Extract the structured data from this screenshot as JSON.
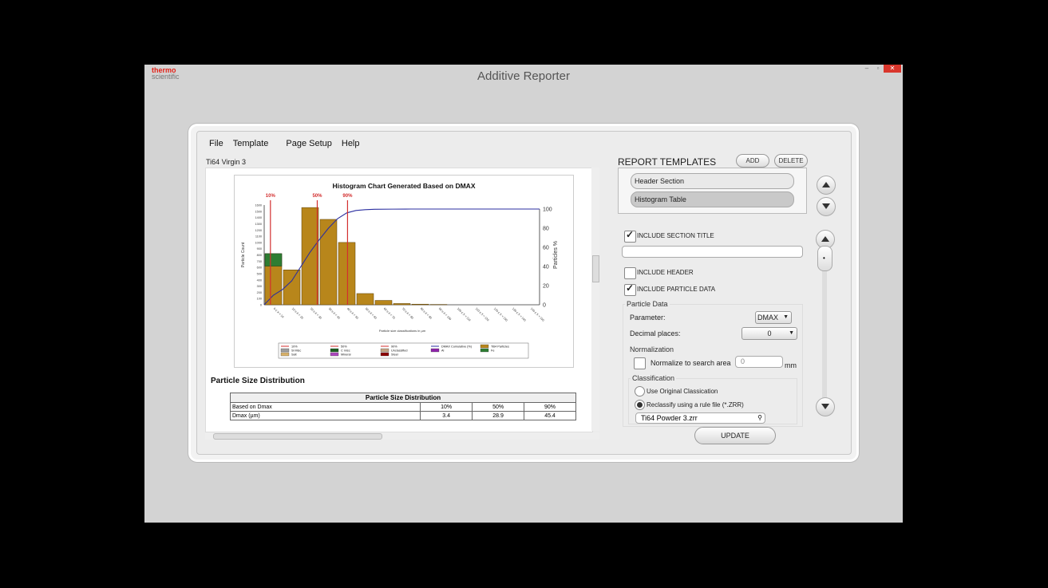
{
  "window": {
    "logo_line1": "thermo",
    "logo_line2": "scientific",
    "title": "Additive Reporter"
  },
  "menu": {
    "file": "File",
    "template": "Template",
    "page_setup": "Page Setup",
    "help": "Help"
  },
  "document": {
    "tab_label": "Ti64 Virgin 3",
    "section_title": "Particle Size Distribution"
  },
  "table": {
    "caption": "Particle Size Distribution",
    "rows": [
      {
        "label": "Based on Dmax",
        "v10": "10%",
        "v50": "50%",
        "v90": "90%"
      },
      {
        "label": "Dmax (µm)",
        "v10": "3.4",
        "v50": "28.9",
        "v90": "45.4"
      }
    ]
  },
  "chart_data": {
    "type": "bar",
    "title": "Histogram Chart Generated Based on DMAX",
    "xlabel": "Particle size classifications in µm",
    "ylabel": "Particle Count",
    "ylabel_right": "Particles %",
    "categories": [
      "0 ≤ X < 10",
      "10 ≤ X < 20",
      "20 ≤ X < 30",
      "30 ≤ X < 40",
      "40 ≤ X < 50",
      "50 ≤ X < 60",
      "60 ≤ X < 70",
      "70 ≤ X < 80",
      "80 ≤ X < 90",
      "90 ≤ X < 100",
      "100 ≤ X < 110",
      "110 ≤ X < 120",
      "120 ≤ X < 130",
      "130 ≤ X < 140",
      "140 ≤ X < 150"
    ],
    "left_ticks": [
      0,
      100,
      200,
      300,
      400,
      500,
      600,
      700,
      800,
      900,
      1000,
      1100,
      1200,
      1300,
      1400,
      1500,
      1600
    ],
    "ylim": [
      0,
      1600
    ],
    "right_ticks": [
      0,
      20,
      40,
      60,
      80,
      100
    ],
    "series": [
      {
        "name": "Ti64 Particles",
        "color": "#b8861b",
        "values": [
          820,
          560,
          1560,
          1370,
          1000,
          180,
          70,
          20,
          10,
          5,
          0,
          0,
          0,
          0,
          0
        ]
      },
      {
        "name": "Fe",
        "color": "#2e7d32",
        "values": [
          200,
          0,
          0,
          0,
          0,
          0,
          0,
          0,
          0,
          0,
          0,
          0,
          0,
          0,
          0
        ]
      },
      {
        "name": "DMAX Cumulative (%)",
        "color": "#2b2fa0",
        "type": "line",
        "x": [
          0,
          5,
          10,
          15,
          20,
          25,
          30,
          35,
          40,
          45,
          50,
          55,
          60,
          70,
          80,
          100,
          150
        ],
        "values": [
          0,
          10,
          16,
          25,
          40,
          55,
          68,
          80,
          90,
          96,
          98.5,
          99.3,
          99.7,
          99.9,
          100,
          100,
          100
        ]
      }
    ],
    "percentile_lines": [
      {
        "label": "10%",
        "x": 3.4
      },
      {
        "label": "50%",
        "x": 28.9
      },
      {
        "label": "90%",
        "x": 45.4
      }
    ],
    "legend": [
      {
        "label": "10%",
        "color": "#d32f2f",
        "kind": "line"
      },
      {
        "label": "50%",
        "color": "#d32f2f",
        "kind": "line"
      },
      {
        "label": "90%",
        "color": "#d32f2f",
        "kind": "line"
      },
      {
        "label": "DMAX Cumulative (%)",
        "color": "#2b2fa0",
        "kind": "line"
      },
      {
        "label": "Ti64 Particles",
        "color": "#b8861b",
        "kind": "box"
      },
      {
        "label": "Si Misc",
        "color": "#9e9e9e",
        "kind": "box"
      },
      {
        "label": "C misc",
        "color": "#1b5e20",
        "kind": "box"
      },
      {
        "label": "Unclassified",
        "color": "#c4a484",
        "kind": "box"
      },
      {
        "label": "Al",
        "color": "#8e24aa",
        "kind": "box"
      },
      {
        "label": "Fe",
        "color": "#2e7d32",
        "kind": "box"
      },
      {
        "label": "Salt",
        "color": "#d9b26b",
        "kind": "box"
      },
      {
        "label": "Mineral",
        "color": "#ab47bc",
        "kind": "box"
      },
      {
        "label": "Steel",
        "color": "#8b0000",
        "kind": "box"
      }
    ],
    "legend_position": "bottom"
  },
  "panel": {
    "title": "REPORT TEMPLATES",
    "add": "ADD",
    "delete": "DELETE",
    "templates": [
      "Header Section",
      "Histogram Table"
    ],
    "include_section_title": "INCLUDE SECTION TITLE",
    "include_header": "INCLUDE HEADER",
    "include_particle_data": "INCLUDE PARTICLE DATA",
    "particle_data_group": "Particle Data",
    "parameter_label": "Parameter:",
    "parameter_value": "DMAX",
    "decimal_label": "Decimal places:",
    "decimal_value": "0",
    "normalization_group": "Normalization",
    "normalize_label": "Normalize to search area",
    "normalize_value": "0",
    "normalize_unit": "mm",
    "classification_group": "Classification",
    "use_original": "Use Original Classication",
    "reclassify": "Reclassify using a rule file (*.ZRR)",
    "rule_file": "Ti64 Powder 3.zrr",
    "update": "UPDATE"
  }
}
